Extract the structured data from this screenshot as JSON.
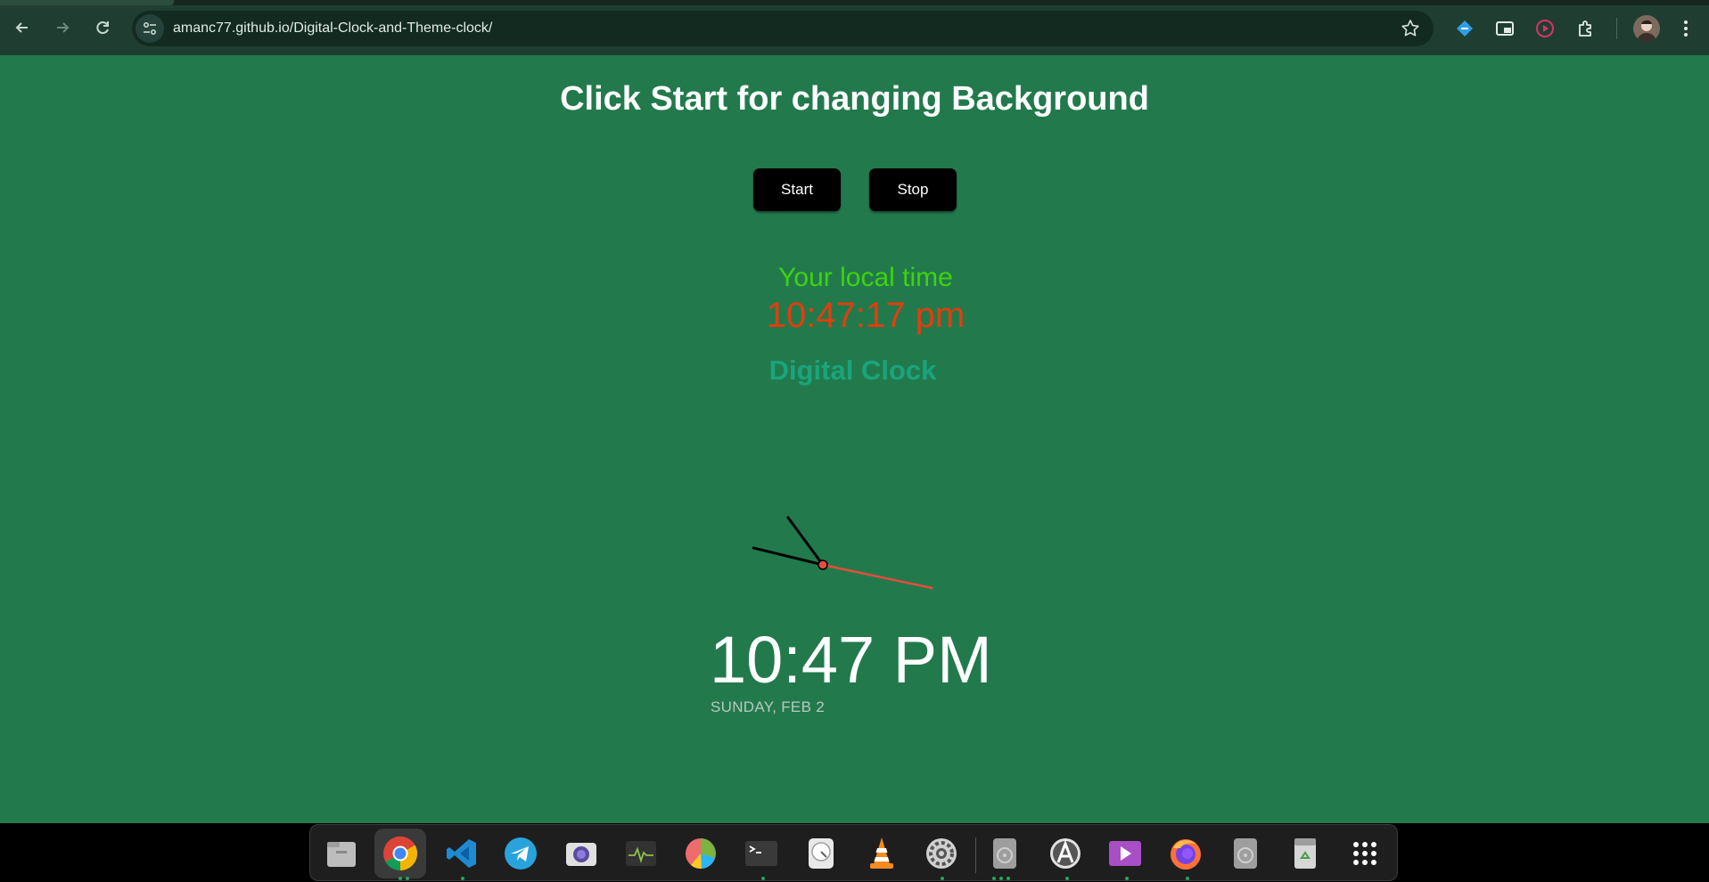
{
  "browser": {
    "url": "amanc77.github.io/Digital-Clock-and-Theme-clock/",
    "back_icon": "arrow-left",
    "forward_icon": "arrow-right",
    "reload_icon": "reload"
  },
  "page": {
    "heading": "Click Start for changing Background",
    "start_label": "Start",
    "stop_label": "Stop",
    "local_time_label": "Your local time",
    "local_time_value": "10:47:17 pm",
    "digital_clock_title": "Digital Clock",
    "analog_clock": {
      "hour": 10,
      "minute": 47,
      "second": 17
    },
    "big_time": "10:47 PM",
    "date": "SUNDAY, FEB 2"
  },
  "colors": {
    "page_background": "#227a4c",
    "local_label": "#3fd30f",
    "local_time": "#e33d0c",
    "digital_clock_title": "#1aa47c",
    "second_hand": "#e74c3c"
  },
  "dock": {
    "apps": [
      "files",
      "chrome",
      "vscode",
      "telegram",
      "screenshot",
      "system-monitor",
      "disk-usage",
      "terminal",
      "disks",
      "vlc",
      "settings",
      "drive",
      "software-updater",
      "video-player",
      "firefox",
      "drive-2",
      "trash",
      "app-grid"
    ]
  }
}
